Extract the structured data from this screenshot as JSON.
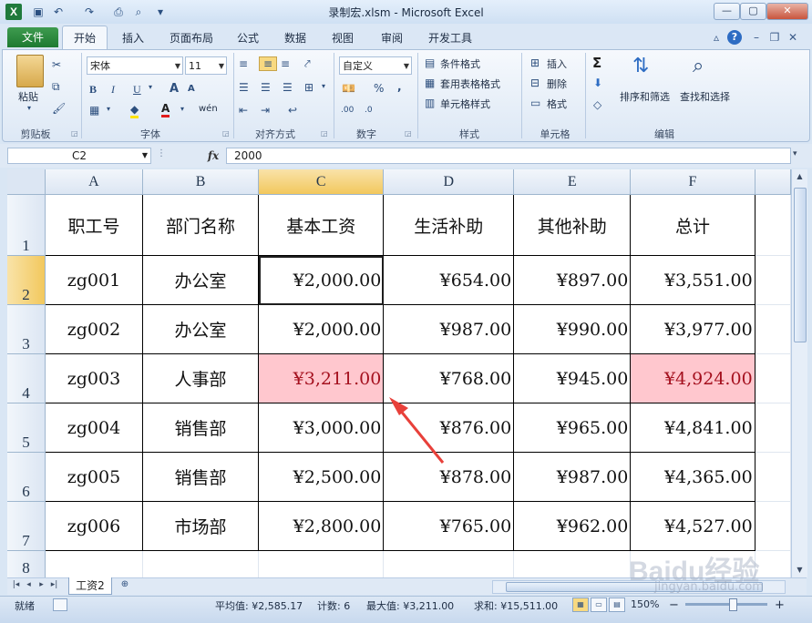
{
  "window": {
    "title": "录制宏.xlsm - Microsoft Excel",
    "app_icon_letter": "X",
    "controls": {
      "minimize": "—",
      "maximize": "▢",
      "close": "✕"
    }
  },
  "quick_access": [
    "save-icon",
    "undo-icon",
    "redo-icon",
    "print-icon",
    "print-preview-icon",
    "customize-icon"
  ],
  "tabs": {
    "file": "文件",
    "items": [
      "开始",
      "插入",
      "页面布局",
      "公式",
      "数据",
      "视图",
      "审阅",
      "开发工具"
    ],
    "active": "开始"
  },
  "ribbon": {
    "clipboard": {
      "paste": "粘贴",
      "label": "剪贴板"
    },
    "font": {
      "name": "宋体",
      "size": "11",
      "label": "字体",
      "bold": "B",
      "italic": "I",
      "underline": "U",
      "grow": "A",
      "shrink": "A",
      "font_color": "A",
      "wen": "wén"
    },
    "alignment": {
      "label": "对齐方式"
    },
    "number": {
      "format": "自定义",
      "label": "数字",
      "percent": "%",
      "comma": ",",
      "inc_decimal": ".00",
      "dec_decimal": ".0"
    },
    "styles": {
      "conditional": "条件格式",
      "table": "套用表格格式",
      "cell": "单元格样式",
      "label": "样式"
    },
    "cells": {
      "insert": "插入",
      "delete": "删除",
      "format": "格式",
      "label": "单元格"
    },
    "editing": {
      "sum": "Σ",
      "sort": "排序和筛选",
      "find": "查找和选择",
      "label": "编辑"
    }
  },
  "formula_bar": {
    "name_box": "C2",
    "fx": "fx",
    "value": "2000"
  },
  "sheet": {
    "columns": [
      "A",
      "B",
      "C",
      "D",
      "E",
      "F"
    ],
    "selected_column": "C",
    "row_numbers": [
      "1",
      "2",
      "3",
      "4",
      "5",
      "6",
      "7",
      "8"
    ],
    "header": [
      "职工号",
      "部门名称",
      "基本工资",
      "生活补助",
      "其他补助",
      "总计"
    ],
    "rows": [
      [
        "zg001",
        "办公室",
        "¥2,000.00",
        "¥654.00",
        "¥897.00",
        "¥3,551.00"
      ],
      [
        "zg002",
        "办公室",
        "¥2,000.00",
        "¥987.00",
        "¥990.00",
        "¥3,977.00"
      ],
      [
        "zg003",
        "人事部",
        "¥3,211.00",
        "¥768.00",
        "¥945.00",
        "¥4,924.00"
      ],
      [
        "zg004",
        "销售部",
        "¥3,000.00",
        "¥876.00",
        "¥965.00",
        "¥4,841.00"
      ],
      [
        "zg005",
        "销售部",
        "¥2,500.00",
        "¥878.00",
        "¥987.00",
        "¥4,365.00"
      ],
      [
        "zg006",
        "市场部",
        "¥2,800.00",
        "¥765.00",
        "¥962.00",
        "¥4,527.00"
      ]
    ],
    "highlight_color": "#ffc7ce",
    "highlight_text_color": "#a4101e"
  },
  "sheet_tabs": {
    "active": "工资2",
    "nav": [
      "|◂",
      "◂",
      "▸",
      "▸|"
    ]
  },
  "status_bar": {
    "mode": "就绪",
    "average": "平均值: ¥2,585.17",
    "count": "计数: 6",
    "max": "最大值: ¥3,211.00",
    "sum": "求和: ¥15,511.00",
    "zoom": "150%",
    "zoom_out": "−",
    "zoom_in": "+"
  },
  "watermark": {
    "text": "Baidu经验",
    "url": "jingyan.baidu.com"
  },
  "annotation": {
    "arrow_color": "#e8403a"
  }
}
